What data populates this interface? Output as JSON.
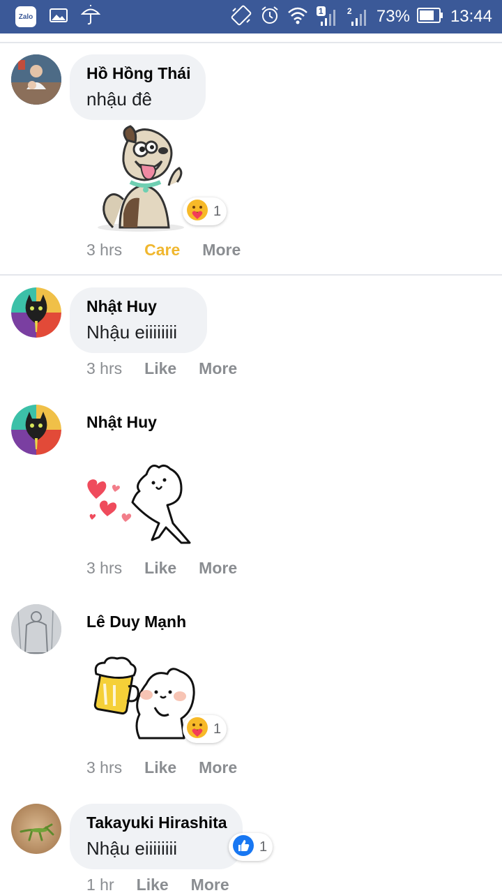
{
  "status_bar": {
    "app_icon_label": "Zalo",
    "sim1_badge": "1",
    "sim2_badge": "2",
    "battery_percent": "73%",
    "time": "13:44"
  },
  "comments": [
    {
      "name": "Hồ Hồng Thái",
      "text": "nhậu đê",
      "sticker": "dog-sticker",
      "reaction": {
        "type": "care",
        "count": "1"
      },
      "time": "3 hrs",
      "action1": "Care",
      "action2": "More"
    },
    {
      "name": "Nhật Huy",
      "text": "Nhậu eiiiiiiii",
      "time": "3 hrs",
      "action1": "Like",
      "action2": "More"
    },
    {
      "name": "Nhật Huy",
      "sticker": "bunny-hearts-sticker",
      "time": "3 hrs",
      "action1": "Like",
      "action2": "More"
    },
    {
      "name": "Lê Duy Mạnh",
      "sticker": "beer-bunny-sticker",
      "reaction": {
        "type": "care",
        "count": "1"
      },
      "time": "3 hrs",
      "action1": "Like",
      "action2": "More"
    },
    {
      "name": "Takayuki Hirashita",
      "text": "Nhậu eiiiiiiii",
      "reaction": {
        "type": "like",
        "count": "1"
      },
      "time": "1 hr",
      "action1": "Like",
      "action2": "More"
    }
  ],
  "colors": {
    "status_bar": "#3b5998",
    "bubble": "#f0f2f5",
    "care": "#f0b72f",
    "muted": "#8a8d91",
    "like_blue": "#1877f2"
  }
}
